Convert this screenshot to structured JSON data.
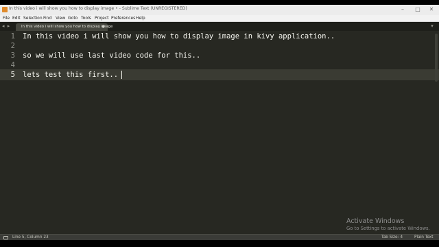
{
  "window": {
    "title": "In this video i will show you how to display image • - Sublime Text (UNREGISTERED)",
    "controls": {
      "minimize": "–",
      "maximize": "□",
      "close": "✕"
    }
  },
  "menu": [
    "File",
    "Edit",
    "Selection",
    "Find",
    "View",
    "Goto",
    "Tools",
    "Project",
    "Preferences",
    "Help"
  ],
  "tabbar": {
    "nav": "◂ ▸",
    "tab_label": "In this video i will show you how to display image",
    "tab_close": "●",
    "overflow": "▾"
  },
  "editor": {
    "line_numbers": [
      "1",
      "2",
      "3",
      "4",
      "5"
    ],
    "lines": [
      "In this video i will show you how to display image in kivy application..",
      "",
      "so we will use last video code for this..",
      "",
      "lets test this first.."
    ],
    "current_line": 5,
    "colors": {
      "background": "#272822",
      "text": "#f8f8f2",
      "gutter": "#8f908a"
    }
  },
  "watermark": {
    "title": "Activate Windows",
    "subtitle": "Go to Settings to activate Windows."
  },
  "status": {
    "position": "Line 5, Column 23",
    "tab_size": "Tab Size: 4",
    "syntax": "Plain Text"
  }
}
